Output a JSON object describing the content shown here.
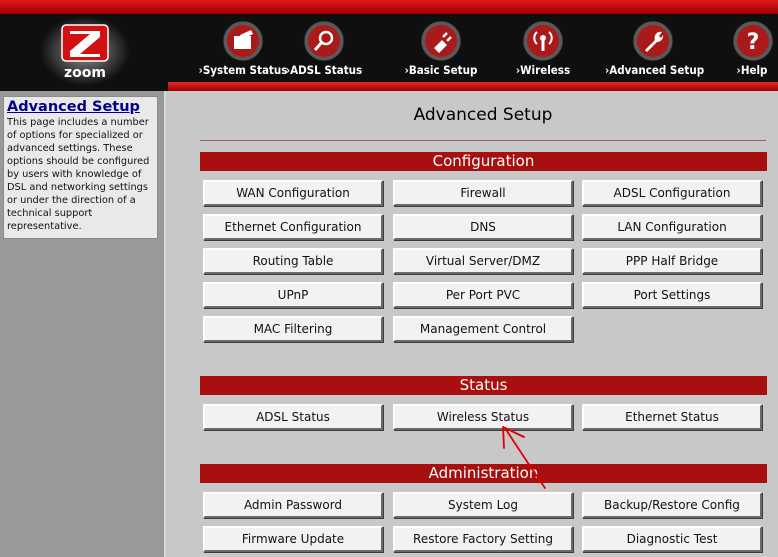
{
  "header": {
    "logo_text": "zoom",
    "nav": [
      {
        "label": "System Status",
        "icon": "folder-icon"
      },
      {
        "label": "ADSL Status",
        "icon": "magnifier-icon"
      },
      {
        "label": "Basic Setup",
        "icon": "plug-icon"
      },
      {
        "label": "Wireless",
        "icon": "wireless-icon"
      },
      {
        "label": "Advanced Setup",
        "icon": "wrench-icon"
      },
      {
        "label": "Help",
        "icon": "question-icon"
      }
    ]
  },
  "sidebar": {
    "title": "Advanced Setup",
    "description": "This page includes a number of options for specialized or advanced settings. These options should be configured by users with knowledge of DSL and networking settings or under the direction of a technical support representative."
  },
  "main": {
    "title": "Advanced Setup",
    "sections": [
      {
        "name": "Configuration",
        "buttons": [
          "WAN Configuration",
          "Firewall",
          "ADSL Configuration",
          "Ethernet Configuration",
          "DNS",
          "LAN Configuration",
          "Routing Table",
          "Virtual Server/DMZ",
          "PPP Half Bridge",
          "UPnP",
          "Per Port PVC",
          "Port Settings",
          "MAC Filtering",
          "Management Control"
        ]
      },
      {
        "name": "Status",
        "buttons": [
          "ADSL Status",
          "Wireless Status",
          "Ethernet Status"
        ]
      },
      {
        "name": "Administration",
        "buttons": [
          "Admin Password",
          "System Log",
          "Backup/Restore Config",
          "Firmware Update",
          "Restore Factory Setting",
          "Diagnostic Test"
        ]
      }
    ]
  },
  "colors": {
    "header_bg": "#0f0f0f",
    "accent_red": "#a80f0f",
    "sidebar_title": "#00008b",
    "annotation_arrow": "#e00000"
  }
}
